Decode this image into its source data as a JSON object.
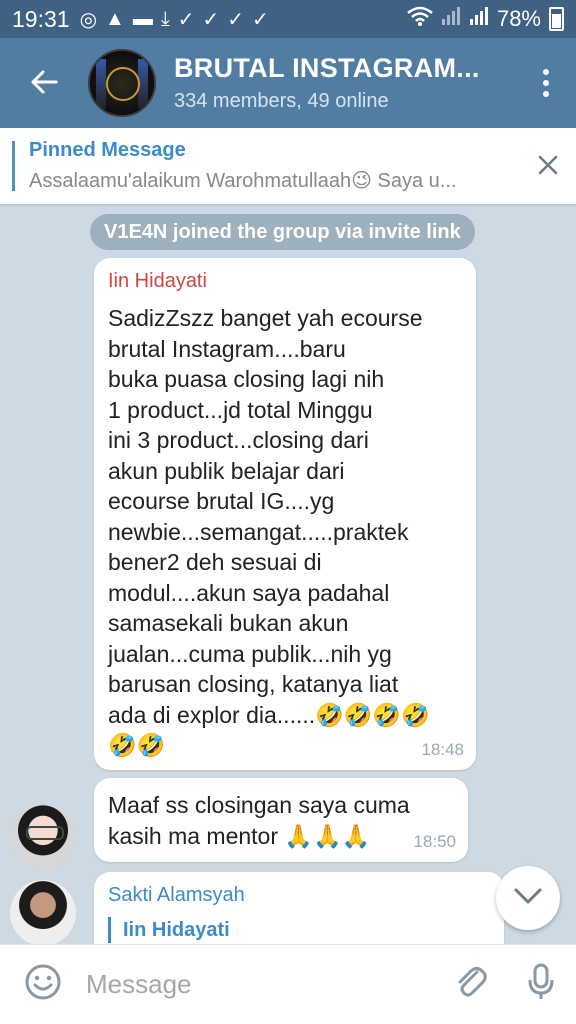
{
  "status_bar": {
    "time": "19:31",
    "battery": "78%"
  },
  "header": {
    "title": "BRUTAL INSTAGRAM...",
    "subtitle": "334 members, 49 online"
  },
  "pinned": {
    "title": "Pinned Message",
    "text": "Assalaamu'alaikum Warohmatullaah😉  Saya u..."
  },
  "service_message": "V1E4N joined the group via invite link",
  "messages": [
    {
      "sender": "Iin Hidayati",
      "text": "SadizZszz banget yah ecourse\nbrutal Instagram....baru\nbuka puasa closing lagi nih\n1 product...jd total Minggu\nini 3 product...closing dari\nakun publik belajar dari\necourse brutal IG....yg\nnewbie...semangat.....praktek\nbener2 deh sesuai di\nmodul....akun saya padahal\nsamasekali bukan akun\njualan...cuma publik...nih yg\nbarusan closing, katanya liat\nada di explor dia......🤣🤣🤣🤣\n🤣🤣",
      "time": "18:48"
    },
    {
      "text": "Maaf ss closingan saya cuma\nkasih ma mentor 🙏🙏🙏",
      "time": "18:50"
    },
    {
      "sender": "Sakti Alamsyah",
      "reply_to": "Iin Hidayati"
    }
  ],
  "input": {
    "placeholder": "Message"
  },
  "colors": {
    "header": "#517da2",
    "status_bar": "#3f6183",
    "chat_background": "#cdd9e3",
    "sender_red": "#cf4740",
    "sender_blue": "#3a8bcd"
  },
  "icons": [
    "back-arrow-icon",
    "more-vert-icon",
    "close-icon",
    "chevron-down-icon",
    "emoji-icon",
    "attach-icon",
    "mic-icon"
  ]
}
